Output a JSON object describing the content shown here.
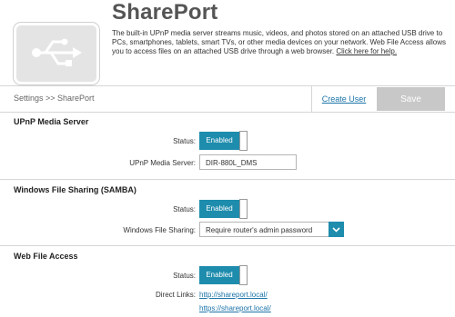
{
  "header": {
    "title": "SharePort",
    "description": "The built-in UPnP media server streams music, videos, and photos stored on an attached USB drive to PCs, smartphones, tablets, smart TVs, or other media devices on your network. Web File Access allows you to access files on an attached USB drive through a web browser.",
    "help_link": "Click here for help."
  },
  "toolbar": {
    "breadcrumb": "Settings >> SharePort",
    "create_user": "Create User",
    "save": "Save"
  },
  "upnp": {
    "title": "UPnP Media Server",
    "status_label": "Status:",
    "status_value": "Enabled",
    "server_label": "UPnP Media Server:",
    "server_value": "DIR-880L_DMS"
  },
  "samba": {
    "title": "Windows File Sharing (SAMBA)",
    "status_label": "Status:",
    "status_value": "Enabled",
    "sharing_label": "Windows File Sharing:",
    "sharing_value": "Require router's admin password"
  },
  "web_access": {
    "title": "Web File Access",
    "status_label": "Status:",
    "status_value": "Enabled",
    "links_label": "Direct Links:",
    "link_http": "http://shareport.local/",
    "link_https": "https://shareport.local/"
  },
  "colors": {
    "accent": "#1e8cad",
    "link": "#1a73a8",
    "save_disabled": "#c8c8c8"
  },
  "icons": {
    "usb": "usb-icon",
    "dropdown": "chevron-down-icon"
  }
}
